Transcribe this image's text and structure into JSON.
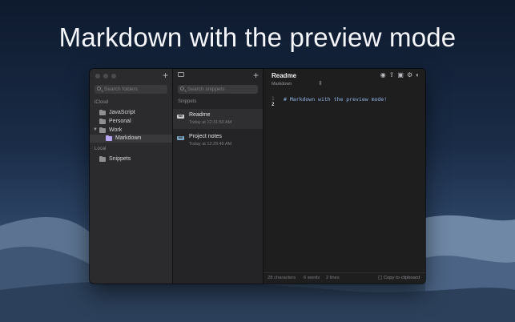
{
  "headline": "Markdown with the preview mode",
  "folders_panel": {
    "add_icon": "plus-icon",
    "search_placeholder": "Search folders",
    "icloud_label": "iCloud",
    "icloud_folders": [
      "JavaScript",
      "Personal",
      "Work"
    ],
    "subfolder": "Markdown",
    "local_label": "Local",
    "local_folders": [
      "Snippets"
    ]
  },
  "snippets_panel": {
    "add_icon": "plus-icon",
    "search_placeholder": "Search snippets",
    "section_label": "Snippets",
    "items": [
      {
        "badge": "MD",
        "title": "Readme",
        "date": "Today at 12:31:50 AM"
      },
      {
        "badge": "MD",
        "title": "Project notes",
        "date": "Today at 12:29:46 AM"
      }
    ]
  },
  "editor": {
    "title": "Readme",
    "language": "Markdown",
    "toolbar_icons": [
      "eye-icon",
      "share-icon",
      "trash-icon",
      "gear-icon",
      "contrast-icon"
    ],
    "line_numbers": [
      "1",
      "2"
    ],
    "code": "# Markdown with the preview mode!",
    "status": {
      "characters": "28 characters",
      "words": "6 words",
      "lines": "2 lines",
      "copy": "Copy to clipboard"
    }
  }
}
